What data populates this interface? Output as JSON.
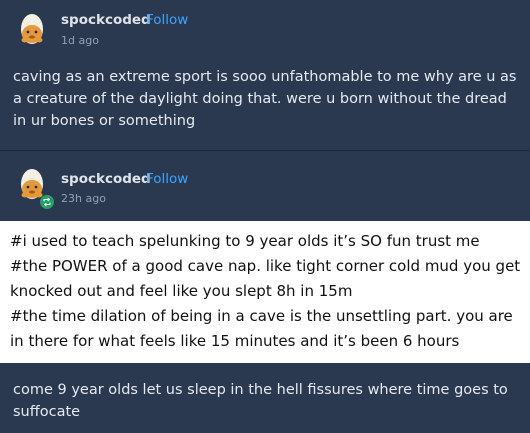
{
  "post1": {
    "username": "spockcoded",
    "follow_label": "Follow",
    "time": "1d ago",
    "text": "caving as an extreme sport is sooo unfathomable to me why are u as a creature of the daylight doing that. were u born without the dread in ur bones or something"
  },
  "post2": {
    "username": "spockcoded",
    "follow_label": "Follow",
    "time": "23h ago",
    "tags": [
      "#i used to teach spelunking to 9 year olds it’s SO fun trust me",
      "#the POWER of a good cave nap. like tight corner cold mud you get knocked out and feel like you slept 8h in 15m",
      "#the time dilation of being in a cave is the unsettling part. you are in there for what feels like 15 minutes and it’s been 6 hours"
    ]
  },
  "post3": {
    "text": "come 9 year olds let us sleep in the hell fissures where time goes to suffocate"
  },
  "colors": {
    "background": "#2a3850",
    "accent": "#3ea3ff",
    "reblog_badge": "#23a063"
  },
  "icons": {
    "avatar": "egg-avatar-icon",
    "reblog": "reblog-icon"
  }
}
